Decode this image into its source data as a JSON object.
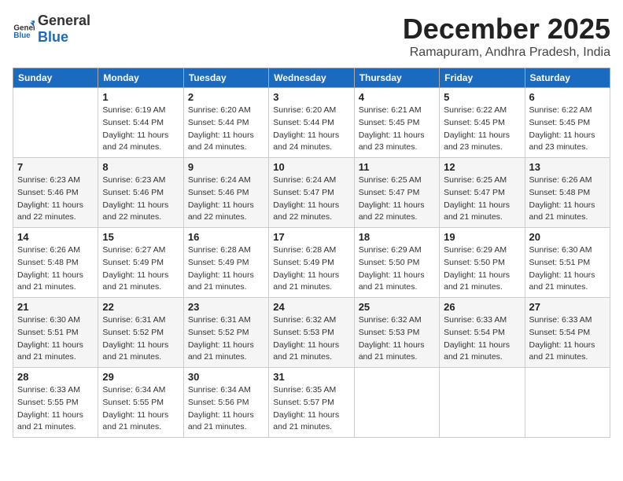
{
  "logo": {
    "general": "General",
    "blue": "Blue"
  },
  "title": "December 2025",
  "location": "Ramapuram, Andhra Pradesh, India",
  "days_header": [
    "Sunday",
    "Monday",
    "Tuesday",
    "Wednesday",
    "Thursday",
    "Friday",
    "Saturday"
  ],
  "weeks": [
    [
      {
        "num": "",
        "empty": true
      },
      {
        "num": "1",
        "sunrise": "6:19 AM",
        "sunset": "5:44 PM",
        "daylight": "11 hours and 24 minutes."
      },
      {
        "num": "2",
        "sunrise": "6:20 AM",
        "sunset": "5:44 PM",
        "daylight": "11 hours and 24 minutes."
      },
      {
        "num": "3",
        "sunrise": "6:20 AM",
        "sunset": "5:44 PM",
        "daylight": "11 hours and 24 minutes."
      },
      {
        "num": "4",
        "sunrise": "6:21 AM",
        "sunset": "5:45 PM",
        "daylight": "11 hours and 23 minutes."
      },
      {
        "num": "5",
        "sunrise": "6:22 AM",
        "sunset": "5:45 PM",
        "daylight": "11 hours and 23 minutes."
      },
      {
        "num": "6",
        "sunrise": "6:22 AM",
        "sunset": "5:45 PM",
        "daylight": "11 hours and 23 minutes."
      }
    ],
    [
      {
        "num": "7",
        "sunrise": "6:23 AM",
        "sunset": "5:46 PM",
        "daylight": "11 hours and 22 minutes."
      },
      {
        "num": "8",
        "sunrise": "6:23 AM",
        "sunset": "5:46 PM",
        "daylight": "11 hours and 22 minutes."
      },
      {
        "num": "9",
        "sunrise": "6:24 AM",
        "sunset": "5:46 PM",
        "daylight": "11 hours and 22 minutes."
      },
      {
        "num": "10",
        "sunrise": "6:24 AM",
        "sunset": "5:47 PM",
        "daylight": "11 hours and 22 minutes."
      },
      {
        "num": "11",
        "sunrise": "6:25 AM",
        "sunset": "5:47 PM",
        "daylight": "11 hours and 22 minutes."
      },
      {
        "num": "12",
        "sunrise": "6:25 AM",
        "sunset": "5:47 PM",
        "daylight": "11 hours and 21 minutes."
      },
      {
        "num": "13",
        "sunrise": "6:26 AM",
        "sunset": "5:48 PM",
        "daylight": "11 hours and 21 minutes."
      }
    ],
    [
      {
        "num": "14",
        "sunrise": "6:26 AM",
        "sunset": "5:48 PM",
        "daylight": "11 hours and 21 minutes."
      },
      {
        "num": "15",
        "sunrise": "6:27 AM",
        "sunset": "5:49 PM",
        "daylight": "11 hours and 21 minutes."
      },
      {
        "num": "16",
        "sunrise": "6:28 AM",
        "sunset": "5:49 PM",
        "daylight": "11 hours and 21 minutes."
      },
      {
        "num": "17",
        "sunrise": "6:28 AM",
        "sunset": "5:49 PM",
        "daylight": "11 hours and 21 minutes."
      },
      {
        "num": "18",
        "sunrise": "6:29 AM",
        "sunset": "5:50 PM",
        "daylight": "11 hours and 21 minutes."
      },
      {
        "num": "19",
        "sunrise": "6:29 AM",
        "sunset": "5:50 PM",
        "daylight": "11 hours and 21 minutes."
      },
      {
        "num": "20",
        "sunrise": "6:30 AM",
        "sunset": "5:51 PM",
        "daylight": "11 hours and 21 minutes."
      }
    ],
    [
      {
        "num": "21",
        "sunrise": "6:30 AM",
        "sunset": "5:51 PM",
        "daylight": "11 hours and 21 minutes."
      },
      {
        "num": "22",
        "sunrise": "6:31 AM",
        "sunset": "5:52 PM",
        "daylight": "11 hours and 21 minutes."
      },
      {
        "num": "23",
        "sunrise": "6:31 AM",
        "sunset": "5:52 PM",
        "daylight": "11 hours and 21 minutes."
      },
      {
        "num": "24",
        "sunrise": "6:32 AM",
        "sunset": "5:53 PM",
        "daylight": "11 hours and 21 minutes."
      },
      {
        "num": "25",
        "sunrise": "6:32 AM",
        "sunset": "5:53 PM",
        "daylight": "11 hours and 21 minutes."
      },
      {
        "num": "26",
        "sunrise": "6:33 AM",
        "sunset": "5:54 PM",
        "daylight": "11 hours and 21 minutes."
      },
      {
        "num": "27",
        "sunrise": "6:33 AM",
        "sunset": "5:54 PM",
        "daylight": "11 hours and 21 minutes."
      }
    ],
    [
      {
        "num": "28",
        "sunrise": "6:33 AM",
        "sunset": "5:55 PM",
        "daylight": "11 hours and 21 minutes."
      },
      {
        "num": "29",
        "sunrise": "6:34 AM",
        "sunset": "5:55 PM",
        "daylight": "11 hours and 21 minutes."
      },
      {
        "num": "30",
        "sunrise": "6:34 AM",
        "sunset": "5:56 PM",
        "daylight": "11 hours and 21 minutes."
      },
      {
        "num": "31",
        "sunrise": "6:35 AM",
        "sunset": "5:57 PM",
        "daylight": "11 hours and 21 minutes."
      },
      {
        "num": "",
        "empty": true
      },
      {
        "num": "",
        "empty": true
      },
      {
        "num": "",
        "empty": true
      }
    ]
  ],
  "labels": {
    "sunrise": "Sunrise:",
    "sunset": "Sunset:",
    "daylight": "Daylight:"
  }
}
